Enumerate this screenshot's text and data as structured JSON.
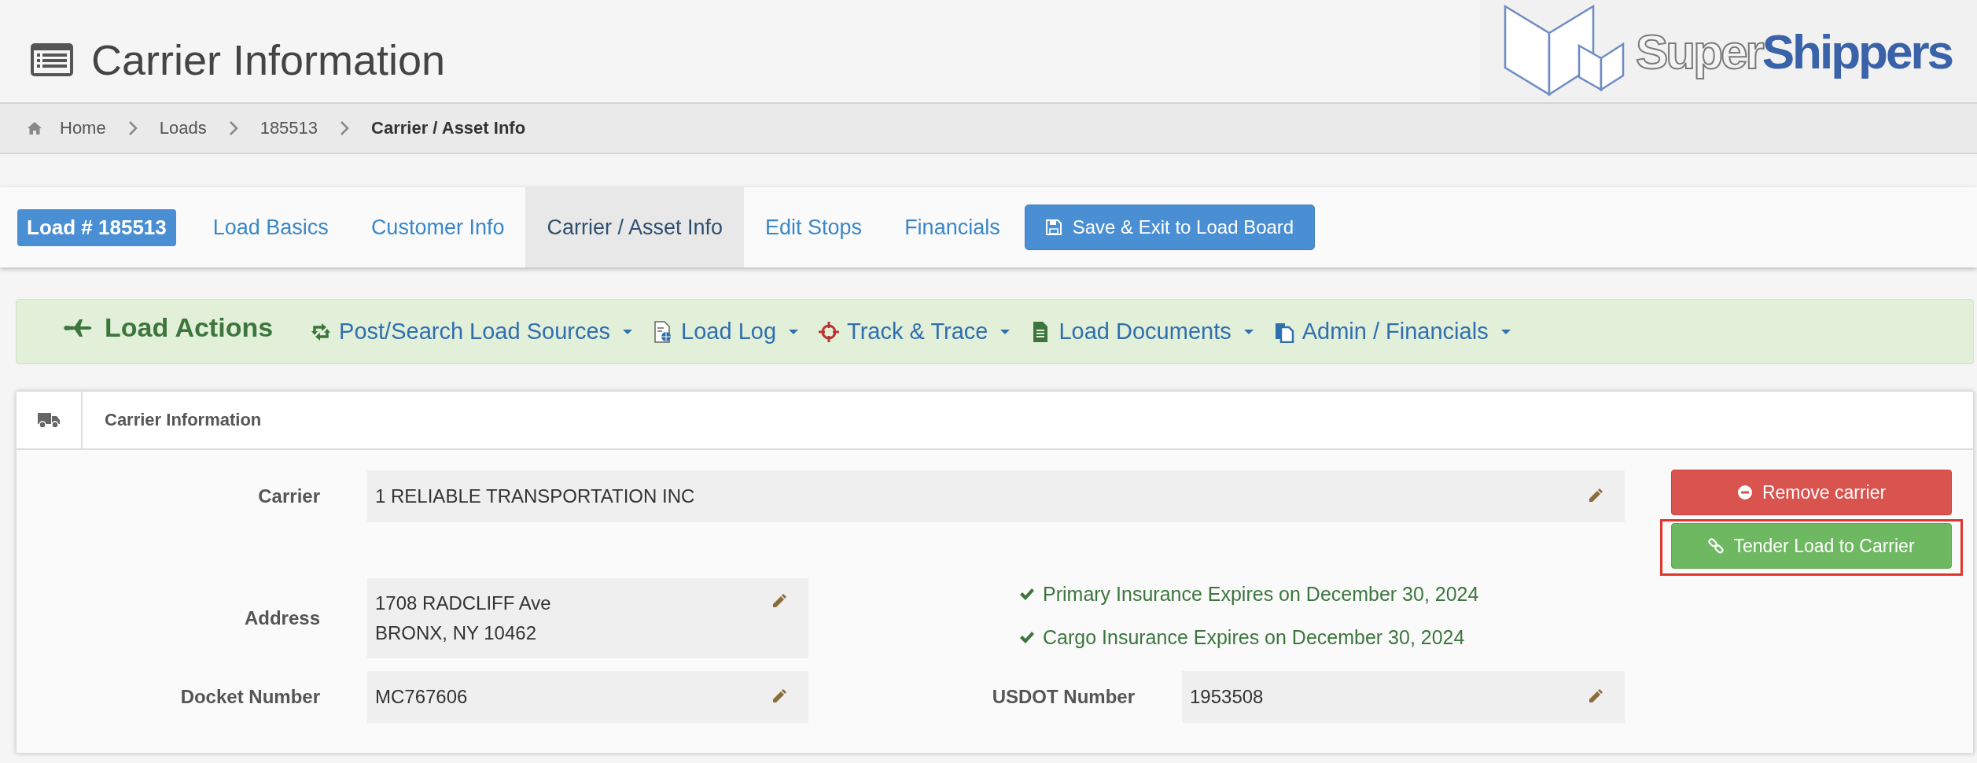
{
  "header": {
    "title": "Carrier Information"
  },
  "logo": {
    "word_1": "Super",
    "word_2": "Shippers"
  },
  "breadcrumb": [
    {
      "label": "Home",
      "current": false
    },
    {
      "label": "Loads",
      "current": false
    },
    {
      "label": "185513",
      "current": false
    },
    {
      "label": "Carrier / Asset Info",
      "current": true
    }
  ],
  "load_badge": "Load # 185513",
  "tabs": [
    {
      "label": "Load Basics",
      "selected": false
    },
    {
      "label": "Customer Info",
      "selected": false
    },
    {
      "label": "Carrier / Asset Info",
      "selected": true
    },
    {
      "label": "Edit Stops",
      "selected": false
    },
    {
      "label": "Financials",
      "selected": false
    }
  ],
  "save_button": "Save & Exit to Load Board",
  "load_actions": {
    "title": "Load Actions",
    "menus": [
      {
        "label": "Post/Search Load Sources",
        "kind": "retweet"
      },
      {
        "label": "Load Log",
        "kind": "log"
      },
      {
        "label": "Track & Trace",
        "kind": "crosshair"
      },
      {
        "label": "Load Documents",
        "kind": "file"
      },
      {
        "label": "Admin / Financials",
        "kind": "copy"
      }
    ]
  },
  "panel": {
    "title": "Carrier Information",
    "carrier": {
      "label": "Carrier",
      "value": "1 RELIABLE TRANSPORTATION INC"
    },
    "address": {
      "label": "Address",
      "lines": [
        "1708 RADCLIFF Ave",
        "BRONX, NY 10462"
      ]
    },
    "docket": {
      "label": "Docket Number",
      "value": "MC767606"
    },
    "usdot": {
      "label": "USDOT Number",
      "value": "1953508"
    },
    "insurance": [
      {
        "text": "Primary Insurance Expires on December 30, 2024",
        "valid": true
      },
      {
        "text": "Cargo Insurance Expires on December 30, 2024",
        "valid": true
      }
    ],
    "buttons": [
      {
        "label": "Remove carrier",
        "kind": "danger",
        "highlighted": false
      },
      {
        "label": "Tender Load to Carrier",
        "kind": "success",
        "highlighted": true
      }
    ]
  }
}
